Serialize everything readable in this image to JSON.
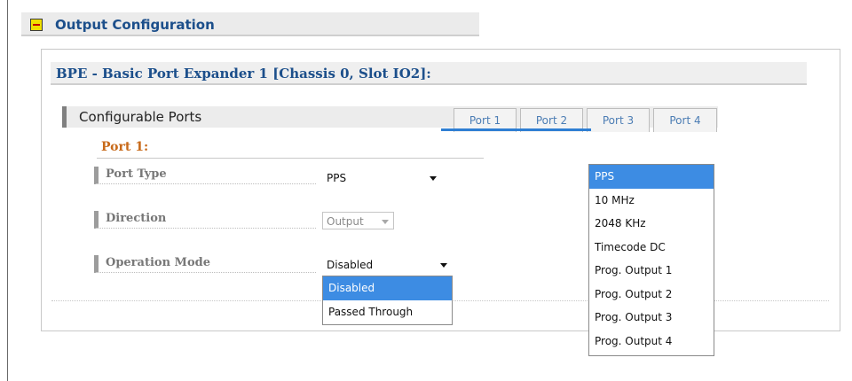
{
  "section": {
    "title": "Output Configuration",
    "collapse_icon": "minus-square-icon"
  },
  "device": {
    "title": "BPE - Basic Port Expander 1 [Chassis 0, Slot IO2]:"
  },
  "ports_bar": {
    "label": "Configurable Ports"
  },
  "tabs": [
    {
      "label": "Port 1"
    },
    {
      "label": "Port 2"
    },
    {
      "label": "Port 3"
    },
    {
      "label": "Port 4"
    }
  ],
  "port": {
    "heading": "Port 1:",
    "fields": {
      "port_type": {
        "label": "Port Type",
        "value": "PPS"
      },
      "direction": {
        "label": "Direction",
        "value": "Output"
      },
      "operation_mode": {
        "label": "Operation Mode",
        "value": "Disabled"
      }
    }
  },
  "port_type_dropdown": {
    "selected": "PPS",
    "options": [
      "PPS",
      "10 MHz",
      "2048 KHz",
      "Timecode DC",
      "Prog. Output 1",
      "Prog. Output 2",
      "Prog. Output 3",
      "Prog. Output 4"
    ]
  },
  "operation_mode_dropdown": {
    "selected": "Disabled",
    "options": [
      "Disabled",
      "Passed Through"
    ]
  },
  "colors": {
    "title_blue": "#1c4f8b",
    "heading_orange": "#c86a1a",
    "selection_blue": "#3d8ce3",
    "connector_blue": "#2f7fd3"
  }
}
